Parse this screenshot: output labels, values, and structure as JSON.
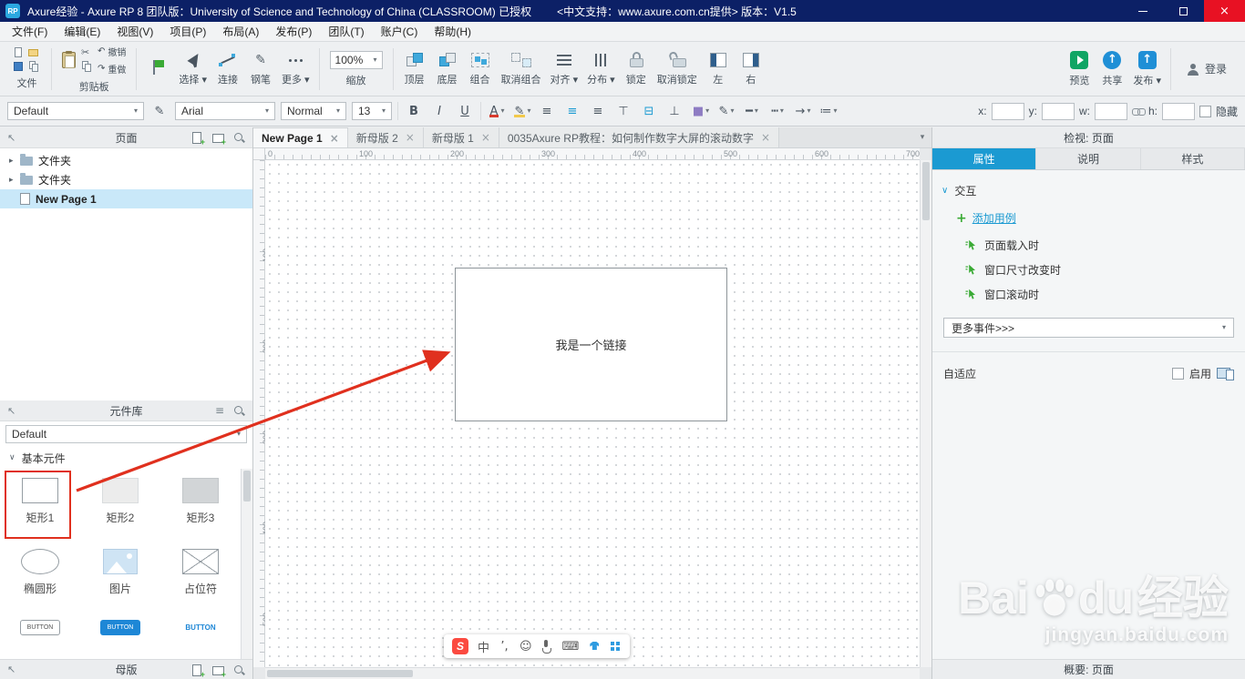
{
  "glyphs": {
    "caret": "▾",
    "close": "×",
    "collapse": "↖",
    "chevron": "∨",
    "plus": "+",
    "hamburger": "≡",
    "scissors": "✂",
    "undo_arrow": "↶",
    "redo_arrow": "↷",
    "brush": "✎"
  },
  "app_colors": {
    "titlebar_bg": "#0c2066",
    "accent_teal": "#1b9ad2",
    "accent_green": "#3aaa35",
    "annotation_red": "#e0301e"
  },
  "titlebar": {
    "logo_text": "RP",
    "title": "Axure经验 - Axure RP 8 团队版：University of Science and Technology of China (CLASSROOM) 已授权",
    "support": "<中文支持：www.axure.com.cn提供> 版本：V1.5"
  },
  "menubar": {
    "items": [
      {
        "label": "文件(F)",
        "name": "menu-file"
      },
      {
        "label": "编辑(E)",
        "name": "menu-edit"
      },
      {
        "label": "视图(V)",
        "name": "menu-view"
      },
      {
        "label": "项目(P)",
        "name": "menu-project"
      },
      {
        "label": "布局(A)",
        "name": "menu-layout"
      },
      {
        "label": "发布(P)",
        "name": "menu-publish"
      },
      {
        "label": "团队(T)",
        "name": "menu-team"
      },
      {
        "label": "账户(C)",
        "name": "menu-account"
      },
      {
        "label": "帮助(H)",
        "name": "menu-help"
      }
    ]
  },
  "toolbar": {
    "file_group": {
      "caption": "文件"
    },
    "clipboard_group": {
      "caption": "剪贴板",
      "undo": "撤销",
      "redo": "重做"
    },
    "mode_items": [
      {
        "caption": "",
        "icon": "flag",
        "name": "interaction-flag-button"
      },
      {
        "caption": "选择 ▾",
        "icon": "select",
        "name": "select-mode-button"
      },
      {
        "caption": "连接",
        "icon": "connect",
        "name": "connect-mode-button"
      },
      {
        "caption": "钢笔",
        "icon": "pen",
        "glyph": "✎",
        "name": "pen-tool-button"
      },
      {
        "caption": "更多 ▾",
        "icon": "more",
        "name": "more-tools-button"
      }
    ],
    "zoom": {
      "value": "100%",
      "caption": "缩放"
    },
    "arrange_items": [
      {
        "caption": "顶层",
        "icon": "front",
        "name": "bring-to-front-button"
      },
      {
        "caption": "底层",
        "icon": "back",
        "name": "send-to-back-button"
      },
      {
        "caption": "组合",
        "icon": "group",
        "name": "group-button"
      },
      {
        "caption": "取消组合",
        "icon": "ungroup",
        "name": "ungroup-button"
      },
      {
        "caption": "对齐 ▾",
        "icon": "align",
        "name": "align-button"
      },
      {
        "caption": "分布 ▾",
        "icon": "dist",
        "name": "distribute-button"
      },
      {
        "caption": "锁定",
        "icon": "lock",
        "name": "lock-button"
      },
      {
        "caption": "取消锁定",
        "icon": "unlock",
        "name": "unlock-button"
      },
      {
        "caption": "左",
        "icon": "pleft",
        "name": "toggle-left-panel-button"
      },
      {
        "caption": "右",
        "icon": "pright",
        "name": "toggle-right-panel-button"
      }
    ],
    "publish_items": [
      {
        "caption": "预览",
        "icon": "preview",
        "name": "preview-button"
      },
      {
        "caption": "共享",
        "icon": "share",
        "name": "share-button"
      },
      {
        "caption": "发布 ▾",
        "icon": "publish",
        "name": "publish-button"
      }
    ],
    "login_label": "登录"
  },
  "formatbar": {
    "style_preset": "Default",
    "font_family": "Arial",
    "font_weight": "Normal",
    "font_size": "13",
    "text_buttons": [
      {
        "glyph": "B",
        "cls": "fb-b",
        "name": "bold-button"
      },
      {
        "glyph": "I",
        "cls": "fb-i",
        "name": "italic-button"
      },
      {
        "glyph": "U",
        "cls": "fb-u",
        "name": "underline-button"
      }
    ],
    "icon_buttons": [
      {
        "glyph": "A",
        "cls": "fc",
        "caret": "▾",
        "name": "font-color-button"
      },
      {
        "glyph": "✎",
        "cls": "hl",
        "caret": "▾",
        "name": "highlight-button"
      },
      {
        "glyph": "≡",
        "cls": "",
        "name": "align-left-button"
      },
      {
        "glyph": "≡",
        "cls": "teal",
        "name": "align-center-button"
      },
      {
        "glyph": "≡",
        "cls": "",
        "name": "align-right-button"
      },
      {
        "glyph": "⊤",
        "cls": "",
        "name": "valign-top-button"
      },
      {
        "glyph": "⊟",
        "cls": "teal",
        "name": "valign-middle-button"
      },
      {
        "glyph": "⊥",
        "cls": "",
        "name": "valign-bottom-button"
      },
      {
        "glyph": "■",
        "cls": "purple",
        "caret": "▾",
        "name": "fill-color-button"
      },
      {
        "glyph": "✎",
        "cls": "",
        "caret": "▾",
        "name": "border-color-button"
      },
      {
        "glyph": "━",
        "cls": "",
        "caret": "▾",
        "name": "border-width-button"
      },
      {
        "glyph": "┅",
        "cls": "",
        "caret": "▾",
        "name": "border-style-button"
      },
      {
        "glyph": "→",
        "cls": "",
        "caret": "▾",
        "name": "arrow-style-button"
      },
      {
        "glyph": "≔",
        "cls": "",
        "caret": "▾",
        "name": "list-style-button"
      }
    ],
    "x_label": "x:",
    "y_label": "y:",
    "w_label": "w:",
    "h_label": "h:",
    "hide_label": "隐藏"
  },
  "pages_panel": {
    "title": "页面",
    "items": [
      {
        "label": "文件夹",
        "arrow": "▸",
        "type": "folder",
        "name": "page-item-folder-1"
      },
      {
        "label": "文件夹",
        "arrow": "▸",
        "type": "folder",
        "name": "page-item-folder-2"
      },
      {
        "label": "New Page 1",
        "arrow": "",
        "type": "page",
        "state": "selected",
        "name": "page-item-new-page-1"
      }
    ]
  },
  "library_panel": {
    "title": "元件库",
    "preset": "Default",
    "section_title": "基本元件",
    "widgets": [
      {
        "label": "矩形1",
        "shape": "w-rect1",
        "text": "",
        "name": "widget-rect1"
      },
      {
        "label": "矩形2",
        "shape": "w-rect2",
        "text": "",
        "name": "widget-rect2"
      },
      {
        "label": "矩形3",
        "shape": "w-rect3",
        "text": "",
        "name": "widget-rect3"
      },
      {
        "label": "椭圆形",
        "shape": "w-ellipse",
        "text": "",
        "name": "widget-ellipse"
      },
      {
        "label": "图片",
        "shape": "w-image",
        "text": "",
        "name": "widget-image"
      },
      {
        "label": "占位符",
        "shape": "w-placeholder",
        "text": "",
        "name": "widget-placeholder"
      },
      {
        "label": "",
        "shape": "w-btn-outline",
        "text": "BUTTON",
        "name": "widget-button"
      },
      {
        "label": "",
        "shape": "w-btn-primary",
        "text": "BUTTON",
        "name": "widget-primary-button"
      },
      {
        "label": "",
        "shape": "w-btn-link",
        "text": "BUTTON",
        "name": "widget-link-button"
      }
    ]
  },
  "masters_panel": {
    "title": "母版"
  },
  "canvas": {
    "tabs": [
      {
        "label": "New Page 1",
        "state": "active",
        "name": "tab-new-page-1"
      },
      {
        "label": "新母版 2",
        "state": "",
        "name": "tab-new-master-2"
      },
      {
        "label": "新母版 1",
        "state": "",
        "name": "tab-new-master-1"
      },
      {
        "label": "0035Axure RP教程：如何制作数字大屏的滚动数字",
        "state": "",
        "name": "tab-0035-tutorial"
      }
    ],
    "h_ruler": [
      "0",
      "100",
      "200",
      "300",
      "400",
      "500",
      "600",
      "700"
    ],
    "v_ruler": [
      "100",
      "200",
      "300",
      "400",
      "500"
    ],
    "widget_text": "我是一个链接"
  },
  "ime_bar": {
    "logo": "S",
    "icons": [
      {
        "glyph": "中",
        "cls": "",
        "name": "ime-chinese-mode-icon"
      },
      {
        "glyph": "’,",
        "cls": "",
        "name": "ime-punctuation-icon"
      },
      {
        "glyph": "☺",
        "cls": "",
        "name": "ime-emoji-icon"
      },
      {
        "glyph": "",
        "cls": "ime-mic",
        "name": "ime-mic-icon"
      },
      {
        "glyph": "⌨",
        "cls": "",
        "name": "ime-keyboard-icon"
      },
      {
        "glyph": "",
        "cls": "ime-skin",
        "name": "ime-skin-icon"
      },
      {
        "glyph": "",
        "cls": "ime-grid",
        "name": "ime-toolbox-icon"
      }
    ]
  },
  "inspector": {
    "header": "检视: 页面",
    "tabs": [
      {
        "label": "属性",
        "state": "active",
        "name": "inspector-tab-properties"
      },
      {
        "label": "说明",
        "state": "",
        "name": "inspector-tab-notes"
      },
      {
        "label": "样式",
        "state": "",
        "name": "inspector-tab-style"
      }
    ],
    "interaction_title": "交互",
    "add_case_label": "添加用例",
    "events": [
      {
        "label": "页面载入时",
        "name": "event-page-load"
      },
      {
        "label": "窗口尺寸改变时",
        "name": "event-window-resize"
      },
      {
        "label": "窗口滚动时",
        "name": "event-window-scroll"
      }
    ],
    "more_events_label": "更多事件>>>",
    "adaptive_label": "自适应",
    "enable_label": "启用",
    "footer": "概要: 页面"
  },
  "watermark": {
    "brand_prefix": "Bai",
    "brand_suffix": "du",
    "suffix_cn": "经验",
    "url": "jingyan.baidu.com"
  }
}
